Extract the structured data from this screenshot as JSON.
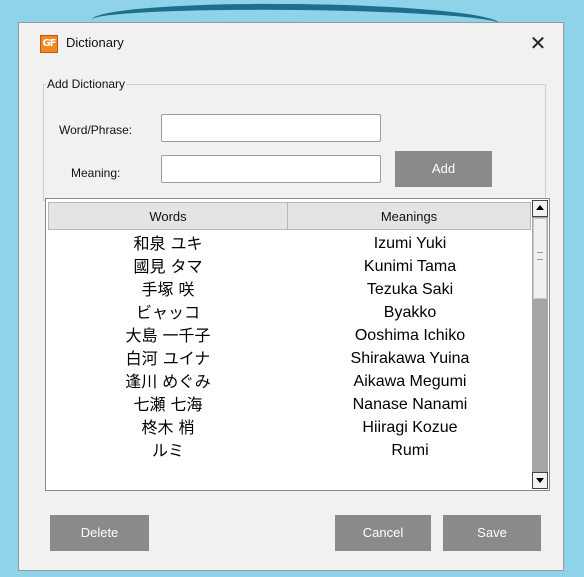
{
  "window": {
    "title": "Dictionary",
    "icon": "app-icon",
    "icon_text": "GF",
    "close_label": "✕"
  },
  "add_group": {
    "legend": "Add Dictionary",
    "word_label": "Word/Phrase:",
    "word_value": "",
    "meaning_label": "Meaning:",
    "meaning_value": "",
    "add_button": "Add"
  },
  "table": {
    "headers": [
      "Words",
      "Meanings"
    ],
    "rows": [
      {
        "word": "和泉 ユキ",
        "meaning": "Izumi Yuki"
      },
      {
        "word": "國見 タマ",
        "meaning": "Kunimi Tama"
      },
      {
        "word": "手塚 咲",
        "meaning": "Tezuka Saki"
      },
      {
        "word": "ビャッコ",
        "meaning": "Byakko"
      },
      {
        "word": "大島 一千子",
        "meaning": "Ooshima Ichiko"
      },
      {
        "word": "白河 ユイナ",
        "meaning": "Shirakawa Yuina"
      },
      {
        "word": "逢川 めぐみ",
        "meaning": "Aikawa Megumi"
      },
      {
        "word": "七瀬 七海",
        "meaning": "Nanase Nanami"
      },
      {
        "word": "柊木 梢",
        "meaning": "Hiiragi Kozue"
      },
      {
        "word": "ルミ",
        "meaning": "Rumi"
      }
    ]
  },
  "footer": {
    "delete_button": "Delete",
    "cancel_button": "Cancel",
    "save_button": "Save"
  },
  "colors": {
    "background": "#8fd3ea",
    "button": "#8a8a8a",
    "icon": "#f08a1e"
  }
}
